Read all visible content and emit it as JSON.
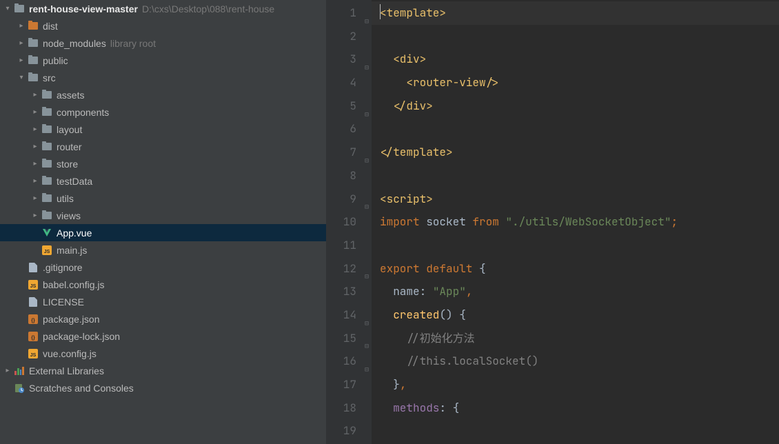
{
  "project": {
    "root": {
      "name": "rent-house-view-master",
      "path": "D:\\cxs\\Desktop\\088\\rent-house"
    },
    "tree": [
      {
        "label": "dist",
        "indent": 1,
        "chev": "right",
        "icon": "folder-excluded"
      },
      {
        "label": "node_modules",
        "hint": "library root",
        "indent": 1,
        "chev": "right",
        "icon": "folder"
      },
      {
        "label": "public",
        "indent": 1,
        "chev": "right",
        "icon": "folder"
      },
      {
        "label": "src",
        "indent": 1,
        "chev": "down",
        "icon": "folder"
      },
      {
        "label": "assets",
        "indent": 2,
        "chev": "right",
        "icon": "folder"
      },
      {
        "label": "components",
        "indent": 2,
        "chev": "right",
        "icon": "folder"
      },
      {
        "label": "layout",
        "indent": 2,
        "chev": "right",
        "icon": "folder"
      },
      {
        "label": "router",
        "indent": 2,
        "chev": "right",
        "icon": "folder"
      },
      {
        "label": "store",
        "indent": 2,
        "chev": "right",
        "icon": "folder"
      },
      {
        "label": "testData",
        "indent": 2,
        "chev": "right",
        "icon": "folder"
      },
      {
        "label": "utils",
        "indent": 2,
        "chev": "right",
        "icon": "folder"
      },
      {
        "label": "views",
        "indent": 2,
        "chev": "right",
        "icon": "folder"
      },
      {
        "label": "App.vue",
        "indent": 2,
        "chev": "",
        "icon": "vue",
        "selected": true
      },
      {
        "label": "main.js",
        "indent": 2,
        "chev": "",
        "icon": "js"
      },
      {
        "label": ".gitignore",
        "indent": 1,
        "chev": "",
        "icon": "generic"
      },
      {
        "label": "babel.config.js",
        "indent": 1,
        "chev": "",
        "icon": "js"
      },
      {
        "label": "LICENSE",
        "indent": 1,
        "chev": "",
        "icon": "generic"
      },
      {
        "label": "package.json",
        "indent": 1,
        "chev": "",
        "icon": "json"
      },
      {
        "label": "package-lock.json",
        "indent": 1,
        "chev": "",
        "icon": "json"
      },
      {
        "label": "vue.config.js",
        "indent": 1,
        "chev": "",
        "icon": "js"
      }
    ],
    "external_libraries": "External Libraries",
    "scratches": "Scratches and Consoles"
  },
  "editor": {
    "lines": [
      {
        "n": 1,
        "fold": "-",
        "seg": [
          {
            "c": "tag",
            "t": "<template>"
          }
        ],
        "active": true,
        "indent": 0
      },
      {
        "n": 2,
        "seg": []
      },
      {
        "n": 3,
        "fold": "-",
        "seg": [
          {
            "c": "tag",
            "t": "<div>"
          }
        ],
        "indent": 1
      },
      {
        "n": 4,
        "seg": [
          {
            "c": "tag",
            "t": "<router-view/>"
          }
        ],
        "indent": 2
      },
      {
        "n": 5,
        "fold": "-",
        "seg": [
          {
            "c": "tag",
            "t": "</div>"
          }
        ],
        "indent": 1
      },
      {
        "n": 6,
        "seg": []
      },
      {
        "n": 7,
        "fold": "-",
        "seg": [
          {
            "c": "tag",
            "t": "</template>"
          }
        ],
        "indent": 0
      },
      {
        "n": 8,
        "seg": []
      },
      {
        "n": 9,
        "fold": "-",
        "seg": [
          {
            "c": "tag",
            "t": "<script>"
          }
        ],
        "indent": 0
      },
      {
        "n": 10,
        "seg": [
          {
            "c": "keyword",
            "t": "import "
          },
          {
            "c": "default",
            "t": "socket "
          },
          {
            "c": "keyword",
            "t": "from "
          },
          {
            "c": "string",
            "t": "\"./utils/WebSocketObject\""
          },
          {
            "c": "delim",
            "t": ";"
          }
        ],
        "indent": 0
      },
      {
        "n": 11,
        "seg": []
      },
      {
        "n": 12,
        "fold": "-",
        "seg": [
          {
            "c": "keyword",
            "t": "export default "
          },
          {
            "c": "default",
            "t": "{"
          }
        ],
        "indent": 0
      },
      {
        "n": 13,
        "seg": [
          {
            "c": "default",
            "t": "name: "
          },
          {
            "c": "string",
            "t": "\"App\""
          },
          {
            "c": "delim",
            "t": ","
          }
        ],
        "indent": 1
      },
      {
        "n": 14,
        "fold": "-",
        "seg": [
          {
            "c": "method",
            "t": "created"
          },
          {
            "c": "default",
            "t": "() {"
          }
        ],
        "indent": 1
      },
      {
        "n": 15,
        "fold": "-",
        "seg": [
          {
            "c": "comment",
            "t": "//初始化方法"
          }
        ],
        "indent": 2
      },
      {
        "n": 16,
        "fold": "-",
        "seg": [
          {
            "c": "comment",
            "t": "//this.localSocket()"
          }
        ],
        "indent": 2
      },
      {
        "n": 17,
        "seg": [
          {
            "c": "default",
            "t": "}"
          },
          {
            "c": "delim",
            "t": ","
          }
        ],
        "indent": 1
      },
      {
        "n": 18,
        "seg": [
          {
            "c": "identifier",
            "t": "methods"
          },
          {
            "c": "default",
            "t": ": {"
          }
        ],
        "indent": 1
      },
      {
        "n": 19,
        "seg": []
      }
    ]
  }
}
